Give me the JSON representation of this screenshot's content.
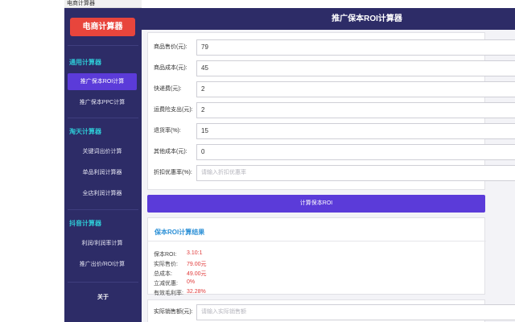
{
  "window": {
    "title": "电商计算器"
  },
  "sidebar": {
    "logo": "电商计算器",
    "groups": [
      {
        "title": "通用计算器",
        "items": [
          {
            "label": "推广保本ROI计算",
            "active": true
          },
          {
            "label": "推广保本PPC计算",
            "active": false
          }
        ]
      },
      {
        "title": "淘天计算器",
        "items": [
          {
            "label": "关键词出价计算",
            "active": false
          },
          {
            "label": "单品利润计算器",
            "active": false
          },
          {
            "label": "全店利润计算器",
            "active": false
          }
        ]
      },
      {
        "title": "抖音计算器",
        "items": [
          {
            "label": "利润/利润率计算",
            "active": false
          },
          {
            "label": "推广出价/ROI计算",
            "active": false
          }
        ]
      }
    ],
    "about": "关于"
  },
  "header": {
    "title": "推广保本ROI计算器"
  },
  "form": {
    "fields": [
      {
        "label": "商品售价(元):",
        "value": "79",
        "placeholder": ""
      },
      {
        "label": "商品成本(元):",
        "value": "45",
        "placeholder": ""
      },
      {
        "label": "快递费(元):",
        "value": "2",
        "placeholder": ""
      },
      {
        "label": "运费险支出(元):",
        "value": "2",
        "placeholder": ""
      },
      {
        "label": "退货率(%):",
        "value": "15",
        "placeholder": ""
      },
      {
        "label": "其他成本(元):",
        "value": "0",
        "placeholder": ""
      },
      {
        "label": "折扣优惠率(%):",
        "value": "",
        "placeholder": "请输入折扣优惠率"
      }
    ],
    "calc_button": "计算保本ROI"
  },
  "result": {
    "title": "保本ROI计算结果",
    "rows": [
      {
        "label": "保本ROI:",
        "value": "3.10:1"
      },
      {
        "label": "实际售价:",
        "value": "79.00元"
      },
      {
        "label": "总成本:",
        "value": "49.00元"
      },
      {
        "label": "立减优惠:",
        "value": "0%"
      },
      {
        "label": "有效毛利率:",
        "value": "32.28%"
      }
    ]
  },
  "sales": {
    "label": "实际销售额(元):",
    "placeholder": "请输入实际销售额"
  },
  "colors": {
    "sidebar": "#2d2c67",
    "accent": "#5b3bd9",
    "logo": "#e8453c",
    "group_title": "#2ecad6",
    "result_value": "#e03c3c"
  }
}
